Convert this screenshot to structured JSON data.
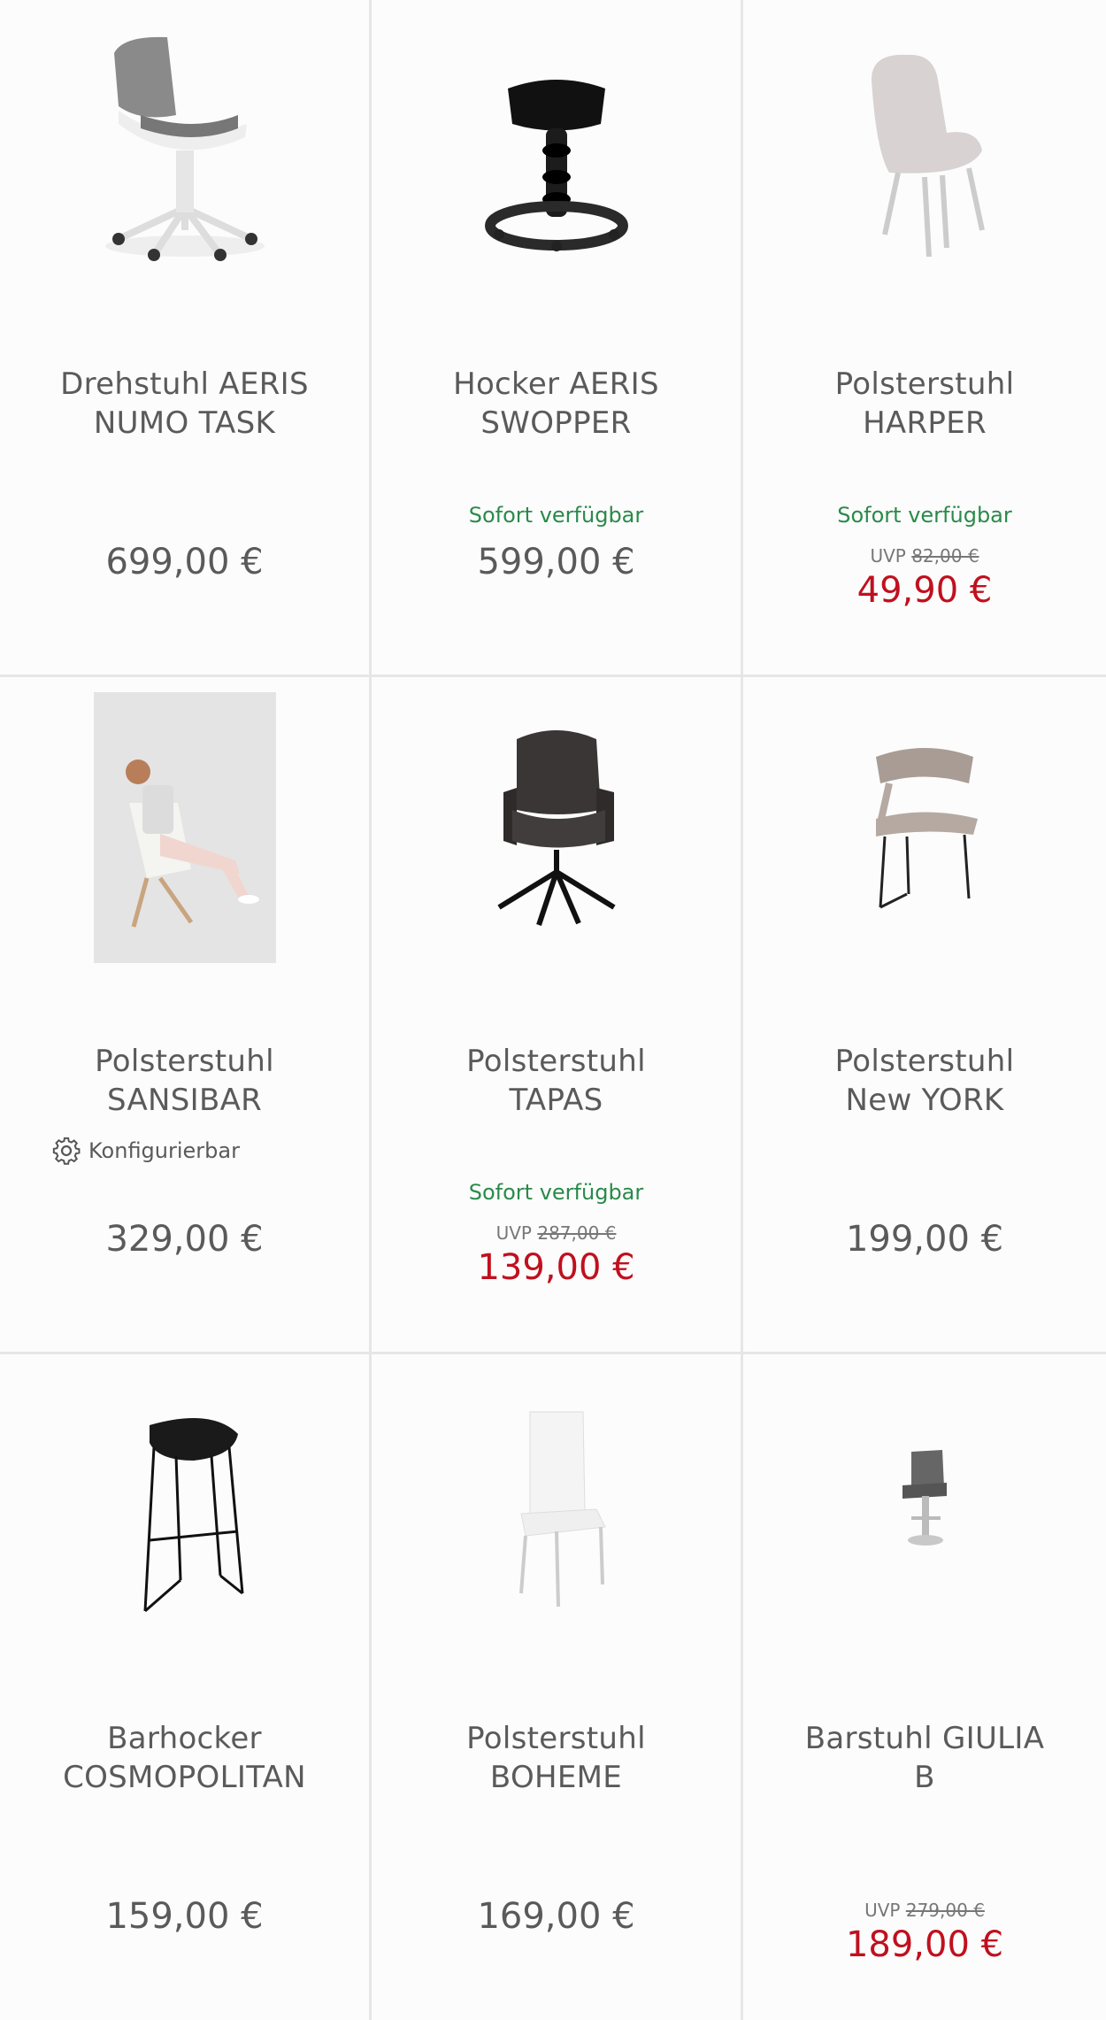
{
  "products": [
    {
      "title_line1": "Drehstuhl AERIS",
      "title_line2": "NUMO TASK",
      "availability": "",
      "uvp_label": "",
      "uvp_price": "",
      "price": "699,00 €",
      "sale_price": "",
      "image": "office-swivel-chair-image"
    },
    {
      "title_line1": "Hocker AERIS",
      "title_line2": "SWOPPER",
      "availability": "Sofort verfügbar",
      "uvp_label": "",
      "uvp_price": "",
      "price": "599,00 €",
      "sale_price": "",
      "image": "swopper-stool-image"
    },
    {
      "title_line1": "Polsterstuhl",
      "title_line2": "HARPER",
      "availability": "Sofort verfügbar",
      "uvp_label": "UVP",
      "uvp_price": "82,00 €",
      "price": "",
      "sale_price": "49,90 €",
      "image": "upholstered-chair-image"
    },
    {
      "title_line1": "Polsterstuhl",
      "title_line2": "SANSIBAR",
      "availability": "",
      "uvp_label": "",
      "uvp_price": "",
      "price": "329,00 €",
      "sale_price": "",
      "image": "woman-on-chair-photo",
      "config_label": "Konfigurierbar"
    },
    {
      "title_line1": "Polsterstuhl",
      "title_line2": "TAPAS",
      "availability": "Sofort verfügbar",
      "uvp_label": "UVP",
      "uvp_price": "287,00 €",
      "price": "",
      "sale_price": "139,00 €",
      "image": "armchair-image"
    },
    {
      "title_line1": "Polsterstuhl",
      "title_line2": "New YORK",
      "availability": "",
      "uvp_label": "",
      "uvp_price": "",
      "price": "199,00 €",
      "sale_price": "",
      "image": "sled-chair-image"
    },
    {
      "title_line1": "Barhocker",
      "title_line2": "COSMOPOLITAN",
      "availability": "",
      "uvp_label": "",
      "uvp_price": "",
      "price": "159,00 €",
      "sale_price": "",
      "image": "bar-stool-image"
    },
    {
      "title_line1": "Polsterstuhl",
      "title_line2": "BOHEME",
      "availability": "",
      "uvp_label": "",
      "uvp_price": "",
      "price": "169,00 €",
      "sale_price": "",
      "image": "white-chair-image"
    },
    {
      "title_line1": "Barstuhl GIULIA",
      "title_line2": "B",
      "availability": "",
      "uvp_label": "UVP",
      "uvp_price": "279,00 €",
      "price": "",
      "sale_price": "189,00 €",
      "image": "barstool-image"
    }
  ],
  "colors": {
    "sale": "#c0101e",
    "available": "#2a8a4a",
    "text": "#5a5a5a"
  }
}
